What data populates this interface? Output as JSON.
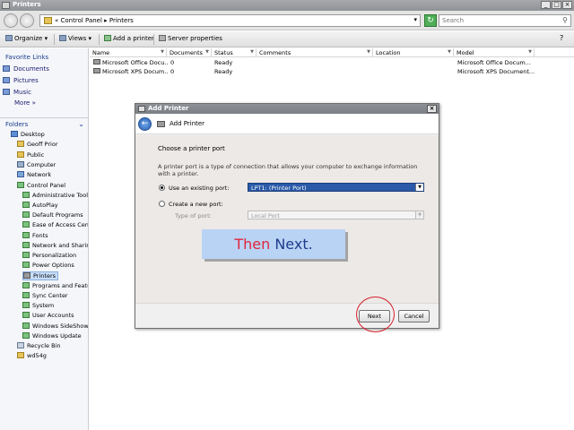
{
  "window": {
    "title": "Printers"
  },
  "address": {
    "crumbs": "« Control Panel ▸ Printers",
    "search_placeholder": "Search"
  },
  "toolbar": {
    "organize": "Organize",
    "views": "Views",
    "add_printer": "Add a printer",
    "server_properties": "Server properties"
  },
  "nav": {
    "favorites_header": "Favorite Links",
    "favorites": [
      "Documents",
      "Pictures",
      "Music",
      "More »"
    ],
    "folders_header": "Folders",
    "tree": [
      "Desktop",
      "Geoff Prior",
      "Public",
      "Computer",
      "Network",
      "Control Panel",
      "Administrative Tools",
      "AutoPlay",
      "Default Programs",
      "Ease of Access Center",
      "Fonts",
      "Network and Sharing Center",
      "Personalization",
      "Power Options",
      "Printers",
      "Programs and Features",
      "Sync Center",
      "System",
      "User Accounts",
      "Windows SideShow",
      "Windows Update",
      "Recycle Bin",
      "wd54g"
    ]
  },
  "columns": [
    "Name",
    "Documents",
    "Status",
    "Comments",
    "Location",
    "Model"
  ],
  "rows": [
    {
      "name": "Microsoft Office Docu...",
      "documents": "0",
      "status": "Ready",
      "model": "Microsoft Office Docum..."
    },
    {
      "name": "Microsoft XPS Docum...",
      "documents": "0",
      "status": "Ready",
      "model": "Microsoft XPS Document..."
    }
  ],
  "dialog": {
    "title": "Add Printer",
    "header": "Add Printer",
    "heading": "Choose a printer port",
    "description": "A printer port is a type of connection that allows your computer to exchange information with a printer.",
    "use_existing_label": "Use an existing port:",
    "use_existing_value": "LPT1: (Printer Port)",
    "create_new_label": "Create a new port:",
    "type_of_port_label": "Type of port:",
    "type_of_port_value": "Local Port",
    "next": "Next",
    "cancel": "Cancel"
  },
  "caption": {
    "word1": "Then",
    "word2": "Next."
  },
  "colors": {
    "caption_bg": "#b9d3f5",
    "caption_red": "#e0273c",
    "caption_blue": "#1f3c8c",
    "circle": "#d71f2b"
  }
}
